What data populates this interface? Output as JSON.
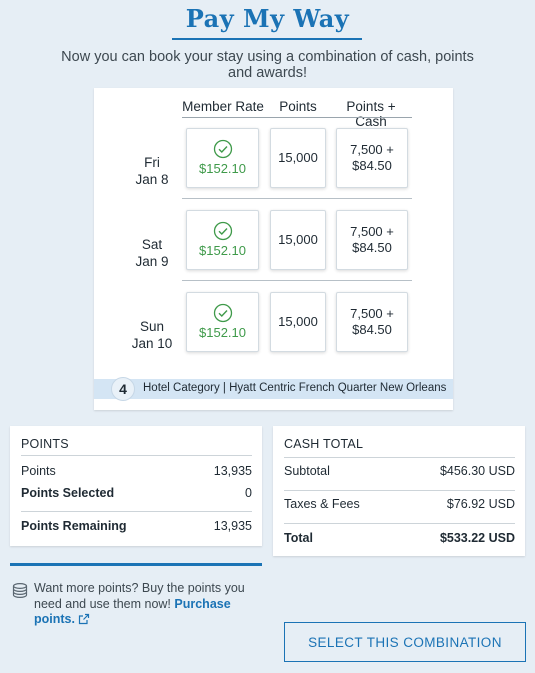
{
  "header": {
    "title": "Pay My Way",
    "subtitle": "Now you can book your stay using a combination of cash, points and awards!"
  },
  "rate_grid": {
    "columns": [
      "Member Rate",
      "Points",
      "Points + Cash"
    ],
    "rows": [
      {
        "day": "Fri",
        "date": "Jan 8",
        "member_rate": "$152.10",
        "points": "15,000",
        "points_cash_line1": "7,500 +",
        "points_cash_line2": "$84.50",
        "selected": "member_rate"
      },
      {
        "day": "Sat",
        "date": "Jan 9",
        "member_rate": "$152.10",
        "points": "15,000",
        "points_cash_line1": "7,500 +",
        "points_cash_line2": "$84.50",
        "selected": "member_rate"
      },
      {
        "day": "Sun",
        "date": "Jan 10",
        "member_rate": "$152.10",
        "points": "15,000",
        "points_cash_line1": "7,500 +",
        "points_cash_line2": "$84.50",
        "selected": "member_rate"
      }
    ],
    "category_number": "4",
    "category_text": "Hotel Category | Hyatt Centric French Quarter New Orleans"
  },
  "points_panel": {
    "heading": "POINTS",
    "rows": [
      {
        "label": "Points",
        "value": "13,935"
      },
      {
        "label": "Points Selected",
        "value": "0"
      },
      {
        "label": "Points Remaining",
        "value": "13,935"
      }
    ]
  },
  "cash_panel": {
    "heading": "CASH TOTAL",
    "rows": [
      {
        "label": "Subtotal",
        "value": "$456.30 USD"
      },
      {
        "label": "Taxes & Fees",
        "value": "$76.92 USD"
      },
      {
        "label": "Total",
        "value": "$533.22 USD"
      }
    ]
  },
  "promo": {
    "text": "Want more points? Buy the points you need and use them now!",
    "link": "Purchase points.",
    "icon": "coins-icon"
  },
  "actions": {
    "select_label": "SELECT THIS COMBINATION"
  },
  "colors": {
    "accent": "#1b73b5",
    "selected_green": "#3f9a4a",
    "background": "#e6eef5"
  }
}
